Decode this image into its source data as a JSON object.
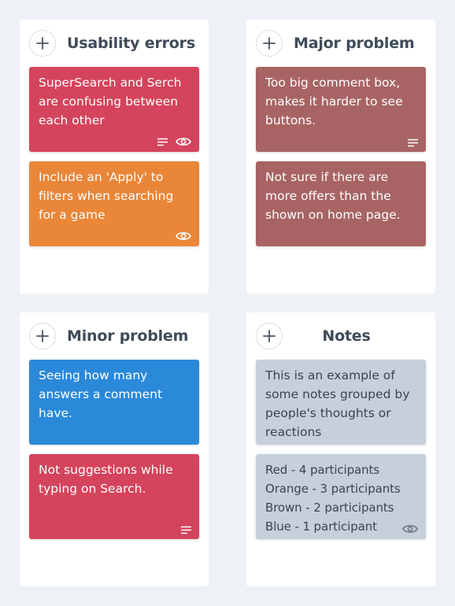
{
  "colors": {
    "red": "#d4445c",
    "orange": "#ea8638",
    "brown": "#a86464",
    "blue": "#2b89d9",
    "gray": "#c6d0da",
    "gray_text": "#3a4450",
    "title": "#3f4b59",
    "background": "#eef1f5"
  },
  "columns": [
    {
      "title": "Usability errors",
      "cards": [
        {
          "text": "SuperSearch and Serch are confusing between each other",
          "color": "red",
          "icons": [
            "lines-icon",
            "eye-icon"
          ]
        },
        {
          "text": "Include an 'Apply' to filters when searching for a game",
          "color": "orange",
          "icons": [
            "eye-icon"
          ]
        }
      ]
    },
    {
      "title": "Major problem",
      "cards": [
        {
          "text": "Too big comment box, makes it harder to see buttons.",
          "color": "brown",
          "icons": [
            "lines-icon"
          ]
        },
        {
          "text": "Not sure if there are more offers than the shown on home page.",
          "color": "brown",
          "icons": []
        }
      ]
    },
    {
      "title": "Minor problem",
      "cards": [
        {
          "text": "Seeing how many answers a comment have.",
          "color": "blue",
          "icons": []
        },
        {
          "text": "Not suggestions while typing on Search.",
          "color": "red",
          "icons": [
            "lines-icon"
          ]
        }
      ]
    },
    {
      "title": "Notes",
      "cards": [
        {
          "text": "This is an example of some notes grouped by people's thoughts or reactions",
          "color": "gray",
          "icons": []
        },
        {
          "text": "Red - 4 participants Orange - 3 participants Brown - 2 participants Blue - 1 participant",
          "color": "gray",
          "icons": [
            "eye-icon"
          ]
        }
      ]
    }
  ]
}
